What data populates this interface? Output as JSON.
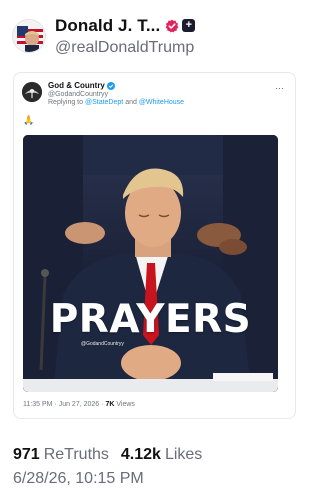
{
  "author": {
    "display_name": "Donald J. T...",
    "handle": "@realDonaldTrump",
    "plus_badge": "+"
  },
  "embedded_post": {
    "source_name": "God & Country",
    "source_handle": "@GodandCountryy",
    "replying_prefix": "Replying to",
    "reply_mention_1": "@StateDept",
    "reply_conjunction": "and",
    "reply_mention_2": "@WhiteHouse",
    "more_label": "…",
    "text_emoji": "🙏",
    "image_caption": "PRAYERS",
    "image_watermark": "@GodandCountryy",
    "meta_time": "11:35 PM",
    "meta_separator_1": "·",
    "meta_date": "Jun 27, 2026",
    "meta_separator_2": "·",
    "meta_views_count": "7K",
    "meta_views_label": "Views"
  },
  "stats": {
    "retruths_count": "971",
    "retruths_label": "ReTruths",
    "likes_count": "4.12k",
    "likes_label": "Likes"
  },
  "post_timestamp": "6/28/26, 10:15 PM",
  "colors": {
    "verified_badge": "#e0245e",
    "link_blue": "#1d9bf0",
    "muted_text": "#6b6b7b"
  }
}
